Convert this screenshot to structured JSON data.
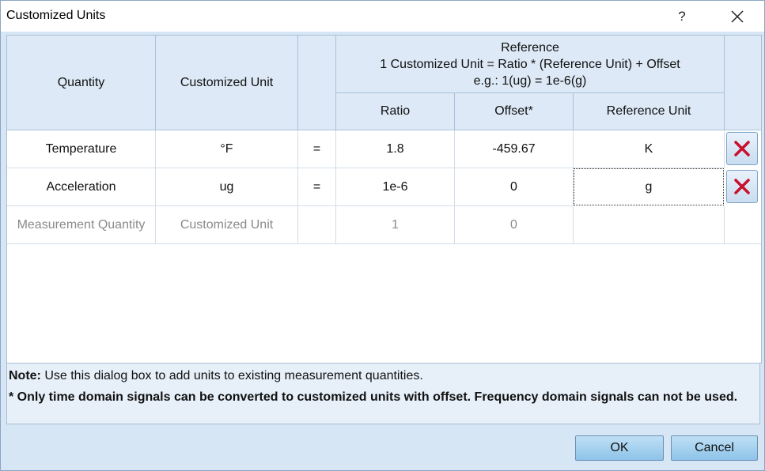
{
  "window": {
    "title": "Customized Units",
    "help_glyph": "?"
  },
  "table": {
    "headers": {
      "quantity": "Quantity",
      "customized_unit": "Customized Unit",
      "equals_col": "",
      "reference_title": "Reference",
      "reference_formula": "1 Customized Unit = Ratio * (Reference Unit) + Offset",
      "reference_example": "e.g.: 1(ug) = 1e-6(g)",
      "ratio": "Ratio",
      "offset": "Offset*",
      "reference_unit": "Reference Unit"
    },
    "rows": [
      {
        "quantity": "Temperature",
        "unit": "°F",
        "equals": "=",
        "ratio": "1.8",
        "offset": "-459.67",
        "reference_unit": "K"
      },
      {
        "quantity": "Acceleration",
        "unit": "ug",
        "equals": "=",
        "ratio": "1e-6",
        "offset": "0",
        "reference_unit": "g"
      }
    ],
    "new_row": {
      "quantity": "Measurement Quantity",
      "unit": "Customized Unit",
      "equals": "",
      "ratio": "1",
      "offset": "0",
      "reference_unit": ""
    }
  },
  "note": {
    "label": "Note:",
    "text": " Use this dialog box to add units to existing measurement quantities.",
    "warning": "* Only time domain signals can be converted to customized units with offset. Frequency domain signals can not be used."
  },
  "buttons": {
    "ok": "OK",
    "cancel": "Cancel"
  },
  "colors": {
    "delete_icon": "#c8102e",
    "header_bg": "#dde9f6",
    "dialog_bg": "#d6e6f5"
  }
}
